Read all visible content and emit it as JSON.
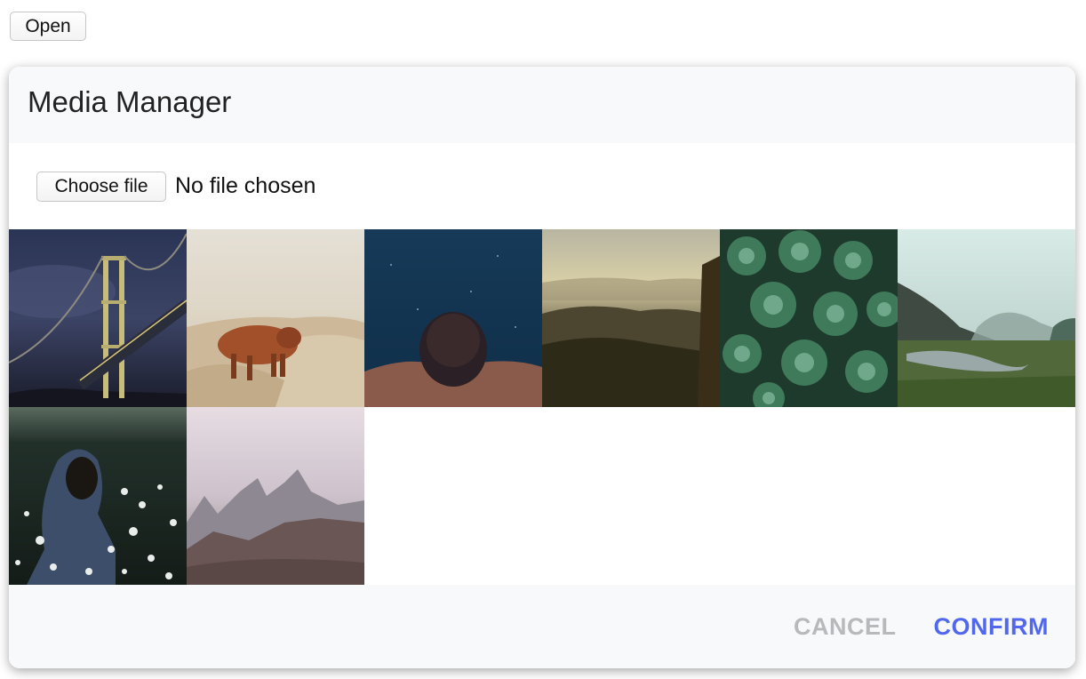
{
  "toolbar": {
    "open_label": "Open"
  },
  "dialog": {
    "title": "Media Manager",
    "file_input": {
      "button_label": "Choose file",
      "status": "No file chosen"
    },
    "images": [
      {
        "subject": "bridge at night"
      },
      {
        "subject": "highland cow on hillside"
      },
      {
        "subject": "swimmer underwater"
      },
      {
        "subject": "misty forest valley"
      },
      {
        "subject": "succulent plants"
      },
      {
        "subject": "river valley with fog"
      },
      {
        "subject": "hooded person in flower field"
      },
      {
        "subject": "mountain peaks at dusk"
      }
    ],
    "footer": {
      "cancel_label": "CANCEL",
      "confirm_label": "CONFIRM"
    },
    "colors": {
      "confirm": "#5168ee",
      "cancel": "#b8b9bc",
      "panel_background": "#f8f9fb"
    }
  }
}
